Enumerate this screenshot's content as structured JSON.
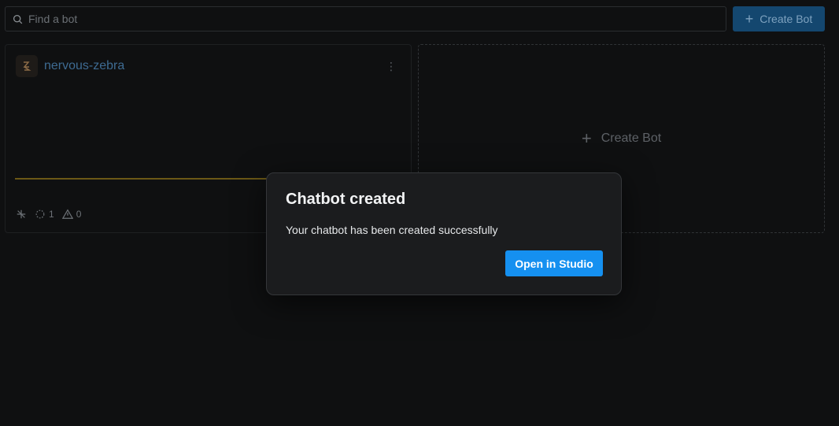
{
  "search": {
    "placeholder": "Find a bot"
  },
  "header": {
    "create_label": "Create Bot"
  },
  "bot_card": {
    "name": "nervous-zebra",
    "icon": "bot-logo-icon",
    "stats": {
      "sessions": "1",
      "warnings": "0"
    },
    "accent_color": "#6b5816"
  },
  "create_card": {
    "label": "Create Bot"
  },
  "modal": {
    "title": "Chatbot created",
    "message": "Your chatbot has been created successfully",
    "action_label": "Open in Studio",
    "action_color": "#1590f0"
  }
}
